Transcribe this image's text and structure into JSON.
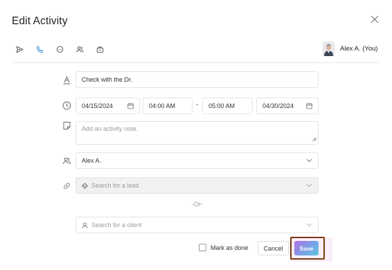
{
  "modal": {
    "title": "Edit Activity",
    "close_icon": "close-icon"
  },
  "activity_types": [
    {
      "icon": "send-icon",
      "active": false
    },
    {
      "icon": "phone-icon",
      "active": true
    },
    {
      "icon": "chat-icon",
      "active": false
    },
    {
      "icon": "people-icon",
      "active": false
    },
    {
      "icon": "briefcase-lock-icon",
      "active": false
    }
  ],
  "owner": {
    "name": "Alex A. (You)"
  },
  "form": {
    "title_value": "Check with the Dr.",
    "start_date": "04/15/2024",
    "start_time": "04:00 AM",
    "time_separator": "-",
    "end_time": "05:00 AM",
    "end_date": "04/30/2024",
    "note_placeholder": "Add an activity note.",
    "assignee_value": "Alex A.",
    "lead_placeholder": "Search for a lead",
    "or_separator": "-Or-",
    "client_placeholder": "Search for a client"
  },
  "footer": {
    "mark_done_label": "Mark as done",
    "mark_done_checked": false,
    "cancel_label": "Cancel",
    "save_label": "Save"
  },
  "colors": {
    "accent": "#3a8fd6",
    "save_gradient_start": "#b06fe4",
    "save_gradient_end": "#5fc7e0",
    "highlight_frame": "#7a3a0a"
  }
}
